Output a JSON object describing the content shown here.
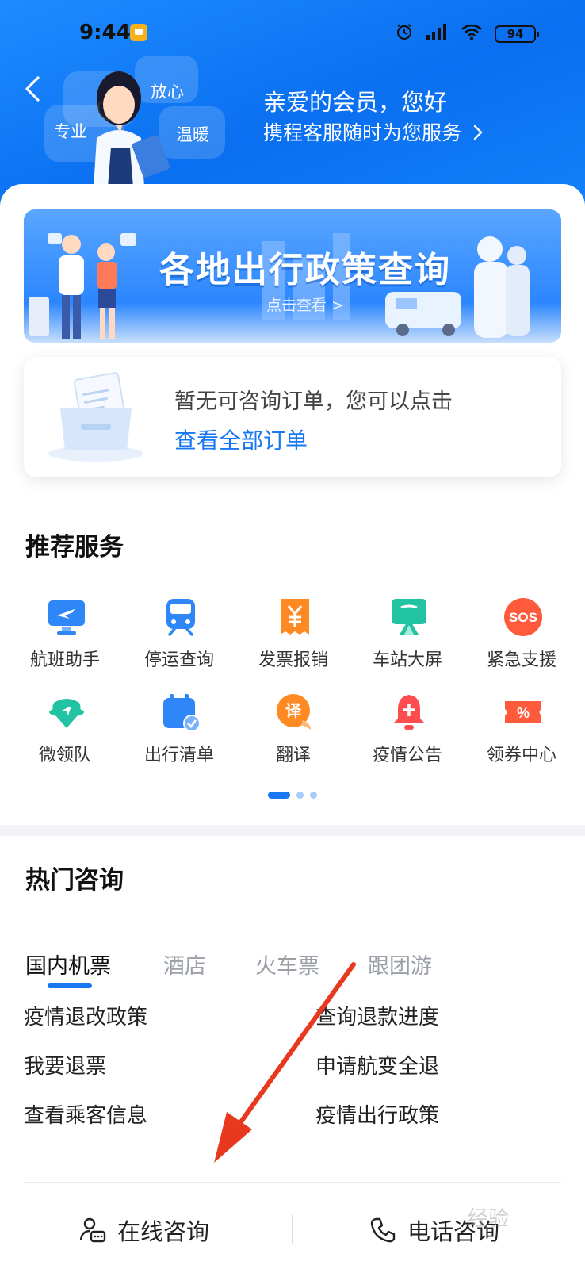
{
  "status_bar": {
    "time": "9:44",
    "battery": "94"
  },
  "header": {
    "greeting": "亲爱的会员，您好",
    "subtitle": "携程客服随时为您服务",
    "tags": [
      "放心",
      "专业",
      "温暖"
    ]
  },
  "banner": {
    "title": "各地出行政策查询",
    "link": "点击查看 >"
  },
  "order_card": {
    "message": "暂无可咨询订单，您可以点击",
    "link": "查看全部订单"
  },
  "recommended": {
    "title": "推荐服务",
    "items": [
      {
        "label": "航班助手",
        "icon": "flight-monitor-icon"
      },
      {
        "label": "停运查询",
        "icon": "train-icon"
      },
      {
        "label": "发票报销",
        "icon": "invoice-icon"
      },
      {
        "label": "车站大屏",
        "icon": "station-screen-icon"
      },
      {
        "label": "紧急支援",
        "icon": "sos-icon"
      },
      {
        "label": "微领队",
        "icon": "guide-icon"
      },
      {
        "label": "出行清单",
        "icon": "calendar-check-icon"
      },
      {
        "label": "翻译",
        "icon": "translate-icon"
      },
      {
        "label": "疫情公告",
        "icon": "bell-plus-icon"
      },
      {
        "label": "领券中心",
        "icon": "coupon-icon"
      }
    ],
    "page_count": 3,
    "current_page": 1
  },
  "hot_faq": {
    "title": "热门咨询",
    "tabs": [
      "国内机票",
      "酒店",
      "火车票",
      "跟团游"
    ],
    "active_tab": 0,
    "left": [
      "疫情退改政策",
      "我要退票",
      "查看乘客信息"
    ],
    "right": [
      "查询退款进度",
      "申请航变全退",
      "疫情出行政策"
    ]
  },
  "bottom_bar": {
    "online": "在线咨询",
    "phone": "电话咨询"
  },
  "watermark": "经验",
  "colors": {
    "brand": "#1778f2",
    "header": "#0a6ff0",
    "annotation_arrow": "#e8391f"
  }
}
